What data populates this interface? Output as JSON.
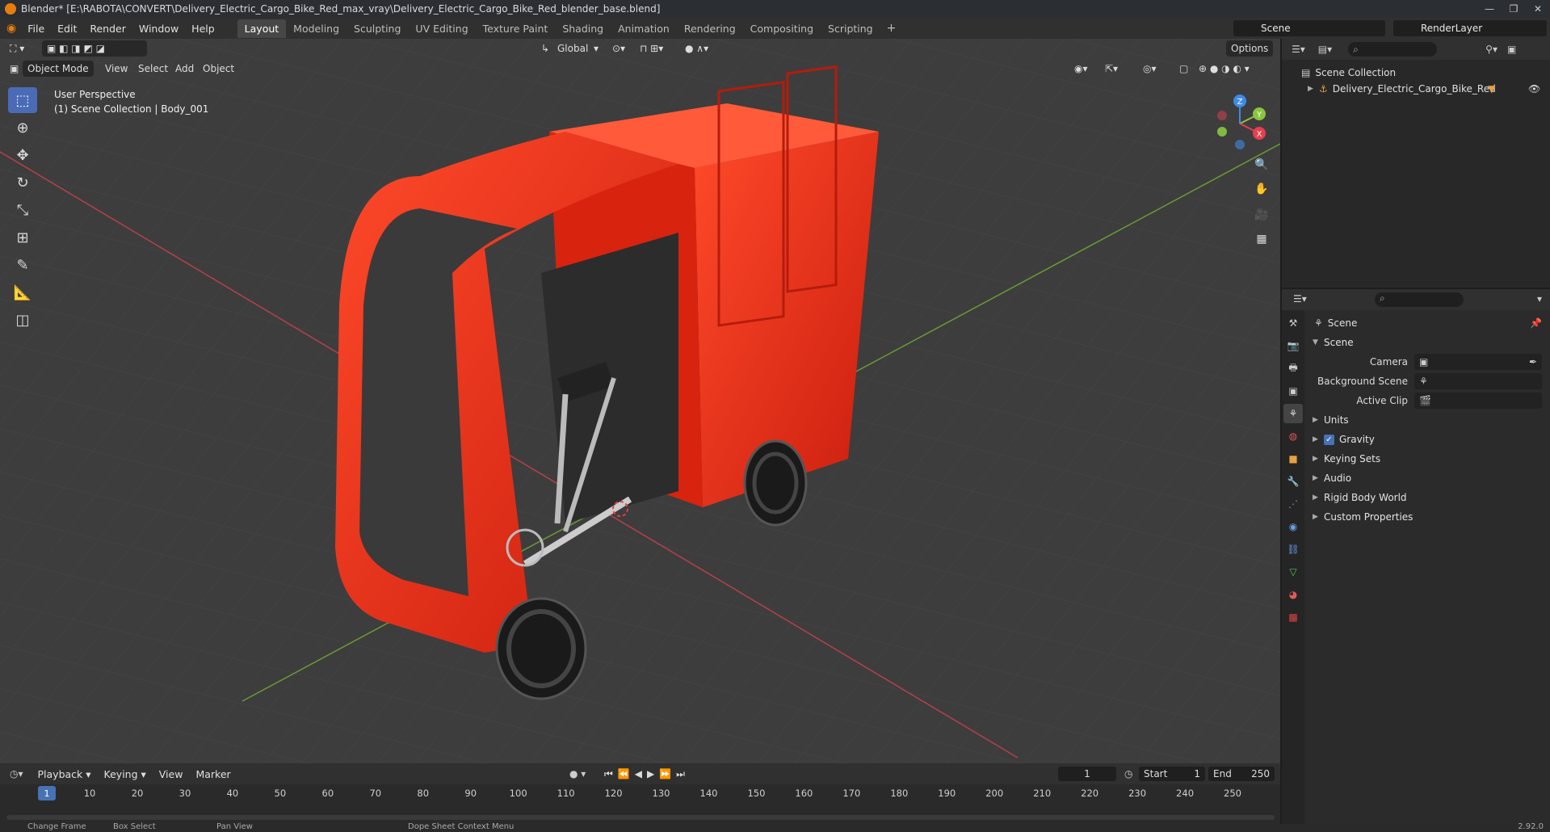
{
  "window": {
    "title": "Blender* [E:\\RABOTA\\CONVERT\\Delivery_Electric_Cargo_Bike_Red_max_vray\\Delivery_Electric_Cargo_Bike_Red_blender_base.blend]",
    "min": "—",
    "max": "❐",
    "close": "✕"
  },
  "menu": [
    "File",
    "Edit",
    "Render",
    "Window",
    "Help"
  ],
  "workspaces": [
    "Layout",
    "Modeling",
    "Sculpting",
    "UV Editing",
    "Texture Paint",
    "Shading",
    "Animation",
    "Rendering",
    "Compositing",
    "Scripting"
  ],
  "active_workspace": "Layout",
  "scene_selector": "Scene",
  "render_layer": "RenderLayer",
  "viewport": {
    "mode": "Object Mode",
    "menus": [
      "View",
      "Select",
      "Add",
      "Object"
    ],
    "transform_orientation": "Global",
    "options_label": "Options",
    "perspective": "User Perspective",
    "collection_info": "(1) Scene Collection | Body_001",
    "gizmo_axes": {
      "x": "X",
      "y": "Y",
      "z": "Z"
    },
    "colors": {
      "x": "#e63f4f",
      "y": "#8ac53f",
      "z": "#3f8ae6",
      "body": "#e6281a"
    }
  },
  "tools": [
    "select-box",
    "cursor",
    "move",
    "rotate",
    "scale",
    "transform",
    "annotate",
    "measure",
    "add-cube"
  ],
  "outliner": {
    "root": "Scene Collection",
    "items": [
      {
        "label": "Delivery_Electric_Cargo_Bike_Red"
      }
    ]
  },
  "properties": {
    "context": "Scene",
    "panel": "Scene",
    "fields": [
      {
        "label": "Camera",
        "value": ""
      },
      {
        "label": "Background Scene",
        "value": ""
      },
      {
        "label": "Active Clip",
        "value": ""
      }
    ],
    "sections": [
      "Units",
      "Gravity",
      "Keying Sets",
      "Audio",
      "Rigid Body World",
      "Custom Properties"
    ],
    "gravity_checked": true
  },
  "timeline": {
    "menus": [
      "Playback",
      "Keying",
      "View",
      "Marker"
    ],
    "current_frame": "1",
    "start_label": "Start",
    "start": "1",
    "end_label": "End",
    "end": "250",
    "ticks": [
      "1",
      "10",
      "20",
      "30",
      "40",
      "50",
      "60",
      "70",
      "80",
      "90",
      "100",
      "110",
      "120",
      "130",
      "140",
      "150",
      "160",
      "170",
      "180",
      "190",
      "200",
      "210",
      "220",
      "230",
      "240",
      "250"
    ]
  },
  "status": {
    "items": [
      "Change Frame",
      "Box Select",
      "Pan View",
      "Dope Sheet Context Menu"
    ],
    "version": "2.92.0"
  }
}
